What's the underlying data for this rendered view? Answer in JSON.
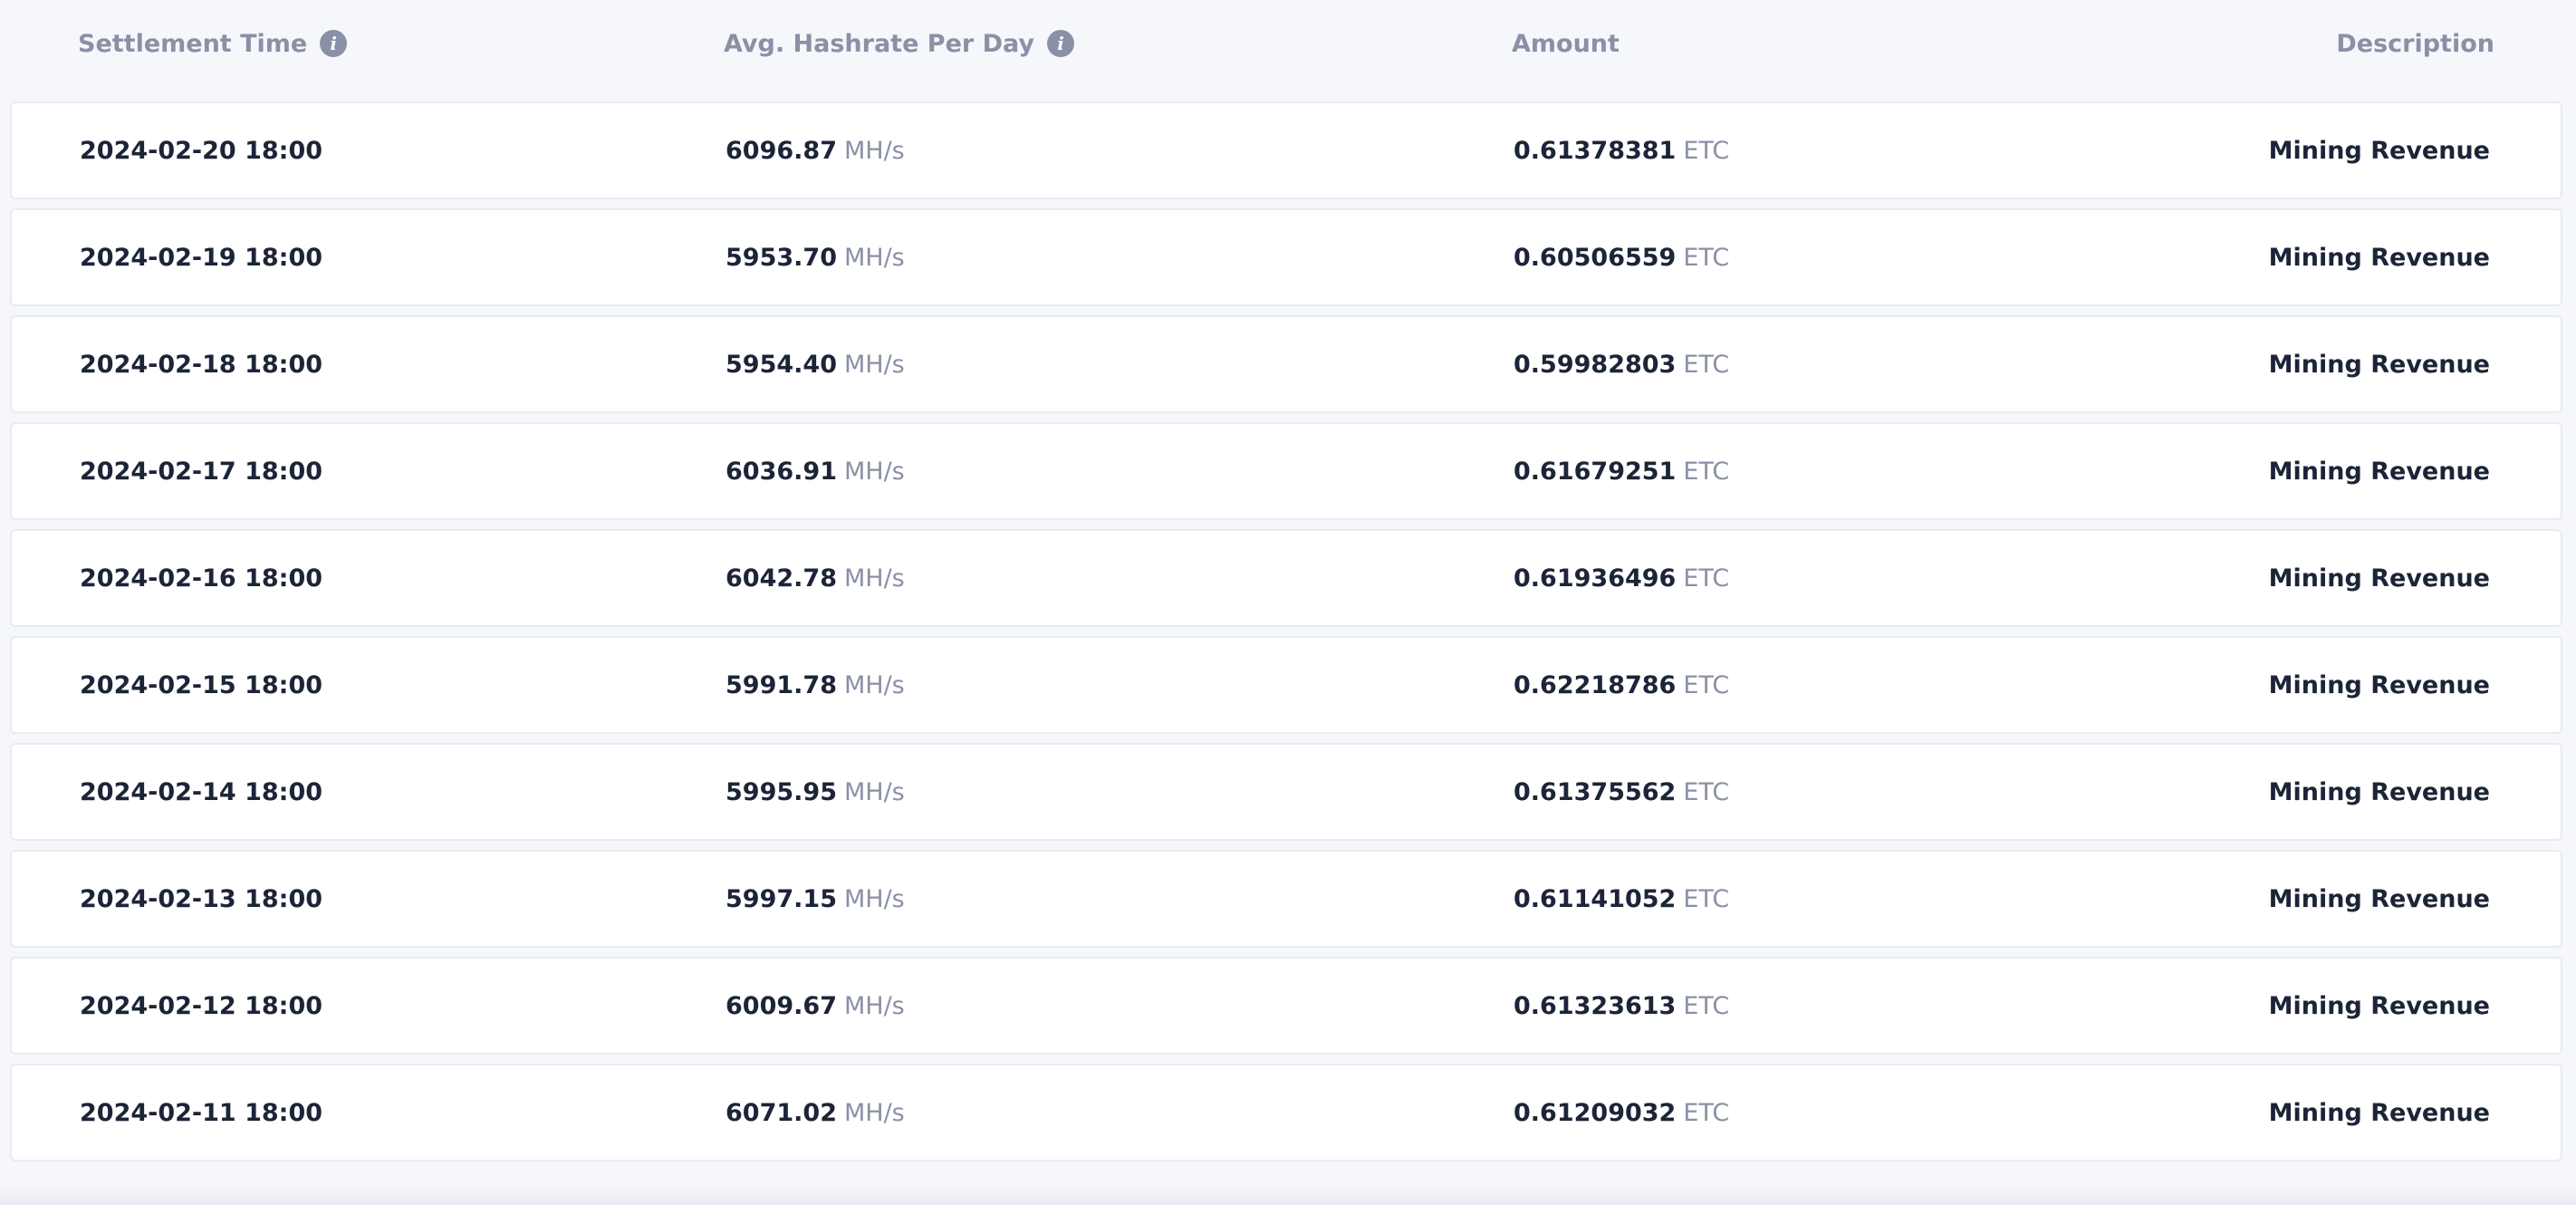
{
  "table": {
    "headers": {
      "settlement_time": "Settlement Time",
      "avg_hashrate": "Avg. Hashrate Per Day",
      "amount": "Amount",
      "description": "Description"
    },
    "info_icon_glyph": "i",
    "rows": [
      {
        "time": "2024-02-20 18:00",
        "hashrate": "6096.87",
        "hashrate_unit": "MH/s",
        "amount": "0.61378381",
        "amount_unit": "ETC",
        "description": "Mining Revenue"
      },
      {
        "time": "2024-02-19 18:00",
        "hashrate": "5953.70",
        "hashrate_unit": "MH/s",
        "amount": "0.60506559",
        "amount_unit": "ETC",
        "description": "Mining Revenue"
      },
      {
        "time": "2024-02-18 18:00",
        "hashrate": "5954.40",
        "hashrate_unit": "MH/s",
        "amount": "0.59982803",
        "amount_unit": "ETC",
        "description": "Mining Revenue"
      },
      {
        "time": "2024-02-17 18:00",
        "hashrate": "6036.91",
        "hashrate_unit": "MH/s",
        "amount": "0.61679251",
        "amount_unit": "ETC",
        "description": "Mining Revenue"
      },
      {
        "time": "2024-02-16 18:00",
        "hashrate": "6042.78",
        "hashrate_unit": "MH/s",
        "amount": "0.61936496",
        "amount_unit": "ETC",
        "description": "Mining Revenue"
      },
      {
        "time": "2024-02-15 18:00",
        "hashrate": "5991.78",
        "hashrate_unit": "MH/s",
        "amount": "0.62218786",
        "amount_unit": "ETC",
        "description": "Mining Revenue"
      },
      {
        "time": "2024-02-14 18:00",
        "hashrate": "5995.95",
        "hashrate_unit": "MH/s",
        "amount": "0.61375562",
        "amount_unit": "ETC",
        "description": "Mining Revenue"
      },
      {
        "time": "2024-02-13 18:00",
        "hashrate": "5997.15",
        "hashrate_unit": "MH/s",
        "amount": "0.61141052",
        "amount_unit": "ETC",
        "description": "Mining Revenue"
      },
      {
        "time": "2024-02-12 18:00",
        "hashrate": "6009.67",
        "hashrate_unit": "MH/s",
        "amount": "0.61323613",
        "amount_unit": "ETC",
        "description": "Mining Revenue"
      },
      {
        "time": "2024-02-11 18:00",
        "hashrate": "6071.02",
        "hashrate_unit": "MH/s",
        "amount": "0.61209032",
        "amount_unit": "ETC",
        "description": "Mining Revenue"
      }
    ]
  },
  "colors": {
    "background": "#f5f7fb",
    "row_background": "#ffffff",
    "text_primary": "#1c2438",
    "text_muted": "#8a90a6"
  }
}
